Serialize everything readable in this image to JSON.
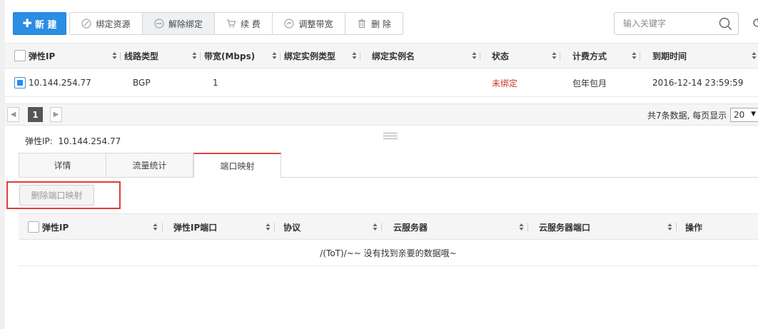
{
  "toolbar": {
    "new_label": "新 建",
    "buttons": [
      {
        "label": "绑定资源",
        "icon": "bind-icon"
      },
      {
        "label": "解除绑定",
        "icon": "unbind-icon"
      },
      {
        "label": "续 费",
        "icon": "cart-icon"
      },
      {
        "label": "调整带宽",
        "icon": "bandwidth-icon"
      },
      {
        "label": "删 除",
        "icon": "trash-icon"
      }
    ],
    "search_placeholder": "输入关键字"
  },
  "table": {
    "columns": [
      "弹性IP",
      "线路类型",
      "带宽(Mbps)",
      "绑定实例类型",
      "绑定实例名",
      "状态",
      "计费方式",
      "到期时间"
    ],
    "rows": [
      {
        "ip": "10.144.254.77",
        "line": "BGP",
        "bandwidth": "1",
        "instance_type": "",
        "instance_name": "",
        "status": "未绑定",
        "billing": "包年包月",
        "expire": "2016-12-14 23:59:59",
        "checked": true
      }
    ],
    "status_color": "#d0342c"
  },
  "pager": {
    "current": "1",
    "info": "共7条数据, 每页显示",
    "page_size": "20"
  },
  "detail": {
    "label": "弹性IP:",
    "ip": "10.144.254.77",
    "tabs": [
      "详情",
      "流量统计",
      "端口映射"
    ],
    "active_tab": "端口映射",
    "delete_button": "删除端口映射",
    "columns": [
      "弹性IP",
      "弹性IP端口",
      "协议",
      "云服务器",
      "云服务器端口",
      "操作"
    ],
    "empty_text": "/(ToT)/~~ 没有找到亲要的数据哦~"
  },
  "colors": {
    "primary": "#2b8de3",
    "highlight": "#e13b3b"
  }
}
